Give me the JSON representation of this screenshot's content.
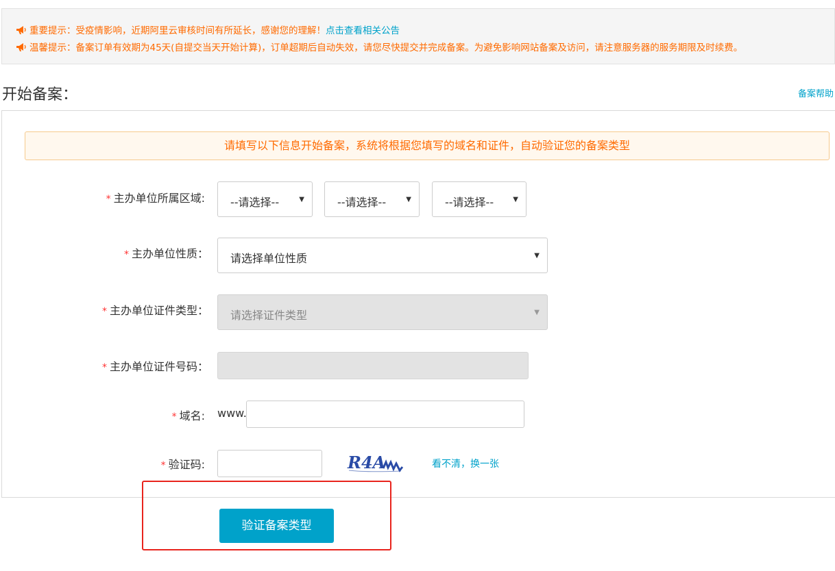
{
  "notice": {
    "line1_text": "重要提示：受疫情影响，近期阿里云审核时间有所延长，感谢您的理解！",
    "line1_link": "点击查看相关公告",
    "line2_text": "温馨提示：备案订单有效期为45天(自提交当天开始计算)，订单超期后自动失效，请您尽快提交并完成备案。为避免影响网站备案及访问，请注意服务器的服务期限及时续费。",
    "icon": "megaphone-icon",
    "accent_color": "#ff6a00"
  },
  "header": {
    "title": "开始备案：",
    "help_link": "备案帮助"
  },
  "form": {
    "hint": "请填写以下信息开始备案，系统将根据您填写的域名和证件，自动验证您的备案类型",
    "required_mark": "*",
    "region": {
      "label": "主办单位所属区域:",
      "options": [
        "--请选择--",
        "--请选择--",
        "--请选择--"
      ]
    },
    "nature": {
      "label": "主办单位性质：",
      "value": "请选择单位性质"
    },
    "cert_type": {
      "label": "主办单位证件类型：",
      "value": "请选择证件类型",
      "disabled": true
    },
    "cert_number": {
      "label": "主办单位证件号码：",
      "value": "",
      "disabled": true
    },
    "domain": {
      "label": "域名:",
      "prefix": "www.",
      "value": ""
    },
    "captcha": {
      "label": "验证码:",
      "value": "",
      "image_text": "R4A",
      "refresh_link": "看不清，换一张"
    },
    "submit_label": "验证备案类型"
  },
  "colors": {
    "primary": "#00a2ca",
    "required": "#ff3333",
    "highlight_box": "#e8231c"
  }
}
